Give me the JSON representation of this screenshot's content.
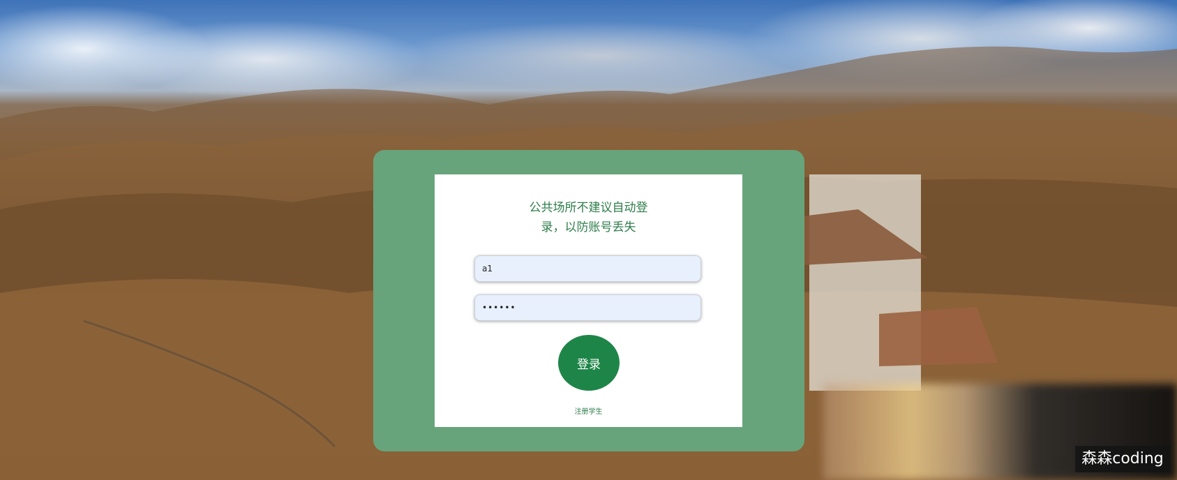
{
  "login": {
    "notice_line1": "公共场所不建议自动登",
    "notice_line2": "录，以防账号丢失",
    "username_value": "a1",
    "password_value": "••••••",
    "login_button": "登录",
    "register_link": "注册学生"
  },
  "watermark": "森森coding",
  "colors": {
    "panel": "#68a47b",
    "card": "#ffffff",
    "accent_text": "#2e7d4a",
    "button": "#1e8548",
    "input_bg": "#e8f0fe"
  }
}
